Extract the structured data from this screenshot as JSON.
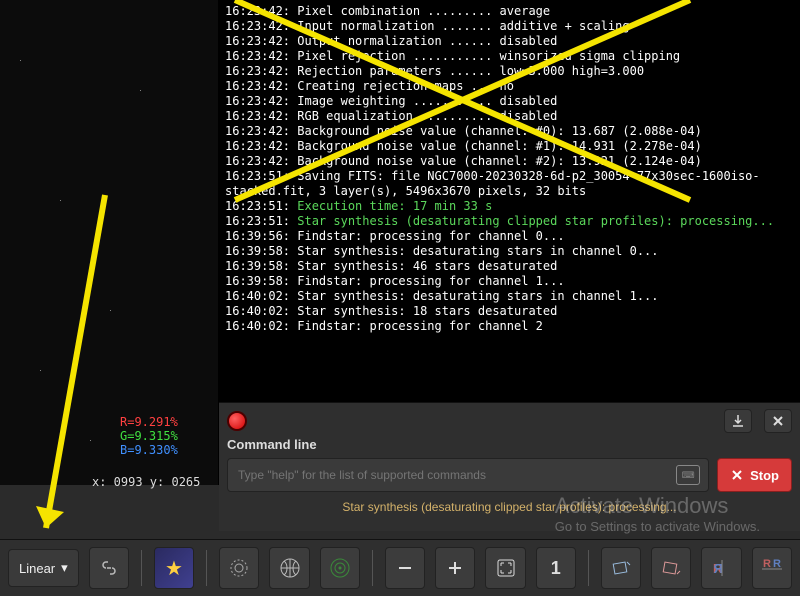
{
  "log": {
    "lines": [
      {
        "ts": "16:23:42:",
        "txt": " Pixel combination ......... average",
        "cls": ""
      },
      {
        "ts": "16:23:42:",
        "txt": " Input normalization ....... additive + scaling",
        "cls": ""
      },
      {
        "ts": "16:23:42:",
        "txt": " Output normalization ...... disabled",
        "cls": ""
      },
      {
        "ts": "16:23:42:",
        "txt": " Pixel rejection ........... winsorized sigma clipping",
        "cls": ""
      },
      {
        "ts": "16:23:42:",
        "txt": " Rejection parameters ...... low=3.000 high=3.000",
        "cls": ""
      },
      {
        "ts": "16:23:42:",
        "txt": " Creating rejection maps ... no",
        "cls": ""
      },
      {
        "ts": "16:23:42:",
        "txt": " Image weighting ........... disabled",
        "cls": ""
      },
      {
        "ts": "16:23:42:",
        "txt": " RGB equalization .......... disabled",
        "cls": ""
      },
      {
        "ts": "16:23:42:",
        "txt": " Background noise value (channel: #0): 13.687 (2.088e-04)",
        "cls": ""
      },
      {
        "ts": "16:23:42:",
        "txt": " Background noise value (channel: #1): 14.931 (2.278e-04)",
        "cls": ""
      },
      {
        "ts": "16:23:42:",
        "txt": " Background noise value (channel: #2): 13.921 (2.124e-04)",
        "cls": ""
      },
      {
        "ts": "16:23:51:",
        "txt": " Saving FITS: file NGC7000-20230328-6d-p2_30054-77x30sec-1600iso-",
        "cls": ""
      },
      {
        "ts": "",
        "txt": "stacked.fit, 3 layer(s), 5496x3670 pixels, 32 bits",
        "cls": ""
      },
      {
        "ts": "16:23:51:",
        "txt": " Execution time: 17 min 33 s",
        "cls": "green"
      },
      {
        "ts": "16:23:51:",
        "txt": " Star synthesis (desaturating clipped star profiles): processing...",
        "cls": "green"
      },
      {
        "ts": "16:39:56:",
        "txt": " Findstar: processing for channel 0...",
        "cls": ""
      },
      {
        "ts": "16:39:58:",
        "txt": " Star synthesis: desaturating stars in channel 0...",
        "cls": ""
      },
      {
        "ts": "16:39:58:",
        "txt": " Star synthesis: 46 stars desaturated",
        "cls": ""
      },
      {
        "ts": "16:39:58:",
        "txt": " Findstar: processing for channel 1...",
        "cls": ""
      },
      {
        "ts": "16:40:02:",
        "txt": " Star synthesis: desaturating stars in channel 1...",
        "cls": ""
      },
      {
        "ts": "16:40:02:",
        "txt": " Star synthesis: 18 stars desaturated",
        "cls": ""
      },
      {
        "ts": "16:40:02:",
        "txt": " Findstar: processing for channel 2",
        "cls": ""
      }
    ]
  },
  "rgb": {
    "r": "R=9.291%",
    "g": "G=9.315%",
    "b": "B=9.330%"
  },
  "coords": "x: 0993 y: 0265",
  "cmd": {
    "label": "Command line",
    "placeholder": "Type \"help\" for the list of supported commands",
    "stop": "Stop",
    "status": "Star synthesis (desaturating clipped star profiles): processing..."
  },
  "toolbar": {
    "linear": "Linear"
  },
  "watermark": {
    "big": "Activate Windows",
    "small": "Go to Settings to activate Windows."
  }
}
